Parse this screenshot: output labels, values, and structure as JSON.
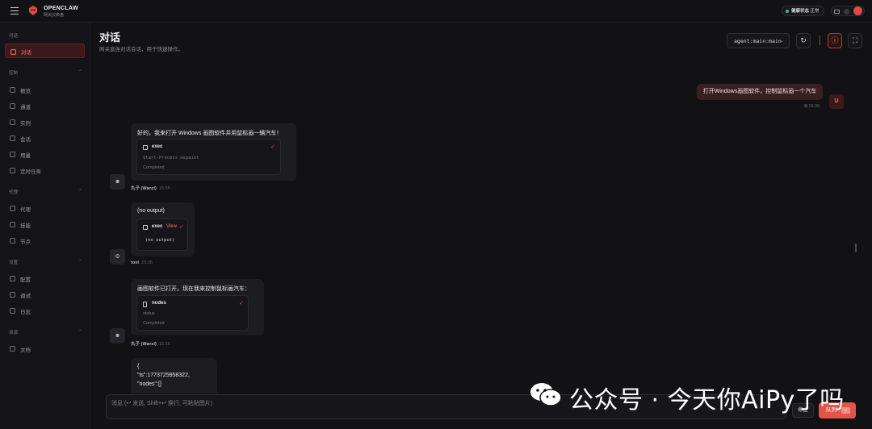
{
  "brand": {
    "name": "OPENCLAW",
    "subtitle": "网关仪表盘"
  },
  "topbar": {
    "health_label": "健康状态",
    "health_value": "正常",
    "health_color": "#2ecc71"
  },
  "sidebar": {
    "sections": [
      {
        "title": "对话",
        "items": [
          {
            "label": "对话",
            "icon": "chat-icon",
            "active": true
          }
        ]
      },
      {
        "title": "控制",
        "items": [
          {
            "label": "概览",
            "icon": "chart-icon"
          },
          {
            "label": "通道",
            "icon": "link-icon"
          },
          {
            "label": "实例",
            "icon": "radio-icon"
          },
          {
            "label": "会话",
            "icon": "document-icon"
          },
          {
            "label": "用量",
            "icon": "bar-chart-icon"
          },
          {
            "label": "定时任务",
            "icon": "clock-icon"
          }
        ]
      },
      {
        "title": "代理",
        "items": [
          {
            "label": "代理",
            "icon": "folder-icon"
          },
          {
            "label": "技能",
            "icon": "sparkle-icon"
          },
          {
            "label": "节点",
            "icon": "monitor-icon"
          }
        ]
      },
      {
        "title": "设置",
        "items": [
          {
            "label": "配置",
            "icon": "gear-icon"
          },
          {
            "label": "调试",
            "icon": "bug-icon"
          },
          {
            "label": "日志",
            "icon": "log-icon"
          }
        ]
      },
      {
        "title": "资源",
        "items": [
          {
            "label": "文档",
            "icon": "book-icon"
          }
        ]
      }
    ]
  },
  "header": {
    "title": "对话",
    "subtitle": "网关直连对话会话，用于快速操作。",
    "agent_select": "agent:main:main"
  },
  "chat": {
    "user_message": {
      "text": "打开Windows画图软件，控制鼠标画一个汽车",
      "time": "15:35",
      "avatar": "U"
    },
    "messages": [
      {
        "text": "好的，我来打开 Windows 画图软件并用鼠标画一辆汽车！",
        "tool": {
          "name": "exec",
          "detail": "Start-Process mspaint",
          "status": "Completed"
        },
        "sender": "丸子 (Wanzi)",
        "time": "15:35"
      },
      {
        "text": "(no output)",
        "tool": {
          "name": "exec",
          "view": "View",
          "detail": "(no output)"
        },
        "sender": "tool",
        "time": "15:35"
      },
      {
        "text": "画图软件已打开。现在我来控制鼠标画汽车：",
        "tool": {
          "name": "nodes",
          "detail": "status",
          "status": "Completed"
        },
        "sender": "丸子 (Wanzi)",
        "time": "15:35"
      },
      {
        "lines": [
          "{",
          "\"ts\":1773725958322,",
          "\"nodes\":[]"
        ]
      }
    ]
  },
  "composer": {
    "placeholder": "消息 (↩ 发送, Shift+↩ 换行, 可粘贴图片)",
    "stop_label": "停止",
    "queue_label": "队列",
    "queue_hint": "↵"
  },
  "watermark": {
    "text": "公众号 · 今天你AiPy了吗"
  },
  "colors": {
    "accent": "#e5534b",
    "background": "#121215"
  }
}
